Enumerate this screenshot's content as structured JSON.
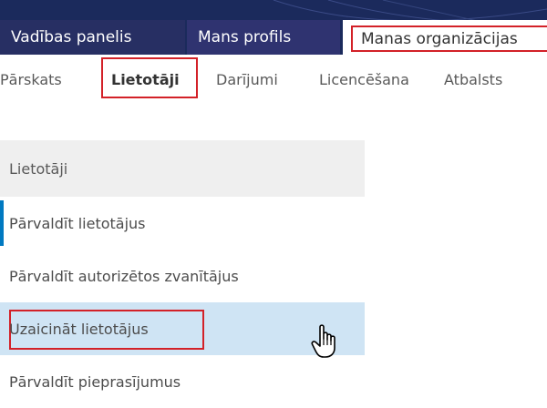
{
  "top_nav": {
    "tabs": [
      {
        "label": "Vadības panelis"
      },
      {
        "label": "Mans profils"
      },
      {
        "label": "Manas organizācijas"
      }
    ]
  },
  "sub_nav": {
    "items": [
      {
        "label": "Pārskats"
      },
      {
        "label": "Lietotāji"
      },
      {
        "label": "Darījumi"
      },
      {
        "label": "Licencēšana"
      },
      {
        "label": "Atbalsts"
      }
    ]
  },
  "side_menu": {
    "header": "Lietotāji",
    "items": [
      {
        "label": "Pārvaldīt lietotājus"
      },
      {
        "label": "Pārvaldīt autorizētos zvanītājus"
      },
      {
        "label": "Uzaicināt lietotājus"
      },
      {
        "label": "Pārvaldīt pieprasījumus"
      }
    ]
  },
  "colors": {
    "banner": "#1b2a5c",
    "accent": "#0079c1",
    "highlight_border": "#d32128",
    "hover_row": "#cfe4f4"
  },
  "icons": {
    "cursor": "hand-pointer-icon"
  }
}
